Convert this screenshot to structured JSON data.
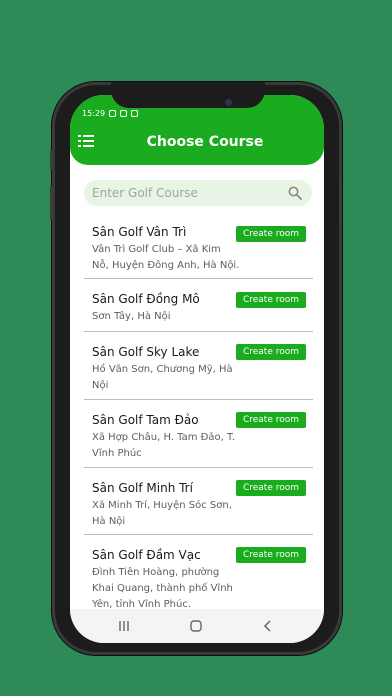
{
  "status": {
    "time": "15:29"
  },
  "header": {
    "title": "Choose Course"
  },
  "search": {
    "placeholder": "Enter Golf Course"
  },
  "courses": [
    {
      "name": "Sân Golf Vân Trì",
      "address": "Vân Trì Golf Club – Xã Kim Nỗ, Huyện Đông Anh, Hà Nội.",
      "button": "Create room"
    },
    {
      "name": "Sân Golf Đồng Mô",
      "address": "Sơn Tây, Hà Nội",
      "button": "Create room"
    },
    {
      "name": "Sân Golf Sky Lake",
      "address": "Hồ Văn Sơn, Chương Mỹ, Hà Nội",
      "button": "Create room"
    },
    {
      "name": "Sân Golf Tam Đảo",
      "address": "Xã Hợp Châu, H. Tam Đảo, T. Vĩnh Phúc",
      "button": "Create room"
    },
    {
      "name": "Sân Golf Minh Trí",
      "address": "Xã Minh Trí, Huyện Sóc Sơn, Hà Nội",
      "button": "Create room"
    },
    {
      "name": "Sân Golf Đầm Vạc",
      "address": "Đình Tiên Hoàng, phường Khai Quang, thành phố Vĩnh Yên, tỉnh Vĩnh Phúc.",
      "button": "Create room"
    }
  ],
  "colors": {
    "accent": "#1aab1f",
    "background": "#2e8b57"
  },
  "icons": {
    "menu": "menu-icon",
    "search": "search-icon",
    "recents": "recents-icon",
    "home": "home-icon",
    "back": "back-icon"
  }
}
